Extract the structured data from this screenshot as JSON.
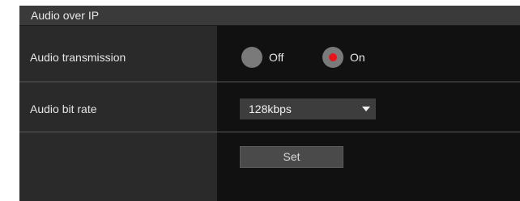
{
  "header": {
    "title": "Audio over IP"
  },
  "audio_transmission": {
    "label": "Audio transmission",
    "options": [
      {
        "label": "Off",
        "selected": false
      },
      {
        "label": "On",
        "selected": true
      }
    ]
  },
  "audio_bit_rate": {
    "label": "Audio bit rate",
    "value": "128kbps"
  },
  "actions": {
    "set_label": "Set"
  },
  "colors": {
    "selected_dot": "#e8141c",
    "radio_circle": "#7a7a7a",
    "label_bg": "#2a2a2a",
    "value_bg": "#111111"
  },
  "icons": {
    "dropdown": "chevron-down-icon"
  }
}
